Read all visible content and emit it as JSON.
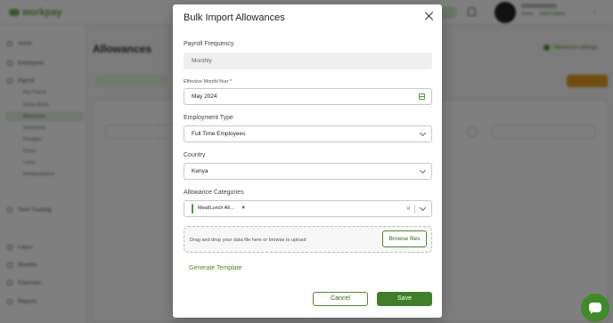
{
  "background": {
    "brand": "workpay",
    "user_role": "Admin",
    "user_link": "Switch Admin",
    "page_title": "Allowances",
    "settings_link": "Allowance settings",
    "sidebar": [
      {
        "label": "Home"
      },
      {
        "label": "Employees"
      },
      {
        "label": "Payroll"
      },
      {
        "label": "Time Tracking"
      },
      {
        "label": "Loans"
      },
      {
        "label": "Benefits"
      },
      {
        "label": "Expenses"
      },
      {
        "label": "Reports"
      }
    ],
    "payroll_sub": [
      "Run Payroll",
      "Salary Rates",
      "Allowances",
      "Deductions",
      "Penalties",
      "Bonus",
      "Loans",
      "Reimbursement"
    ]
  },
  "modal": {
    "title": "Bulk Import Allowances",
    "payroll_frequency": {
      "label": "Payroll Frequency",
      "value": "Monthly"
    },
    "effective": {
      "label": "Effective Month/Year *",
      "value": "May 2024"
    },
    "employment_type": {
      "label": "Employment Type",
      "value": "Full Time Employees"
    },
    "country": {
      "label": "Country",
      "value": "Kenya"
    },
    "categories": {
      "label": "Allowance Categories",
      "chip": "Meal/Lunch All...",
      "chip_remove": "×",
      "clear": "×"
    },
    "upload": {
      "hint": "Drag and drop your data file here or browse to upload",
      "browse_label": "Browse files"
    },
    "generate_template": "Generate Template",
    "cancel_label": "Cancel",
    "save_label": "Save"
  },
  "colors": {
    "brand_green": "#3f7f2a",
    "accent_orange": "#e39a1f"
  }
}
